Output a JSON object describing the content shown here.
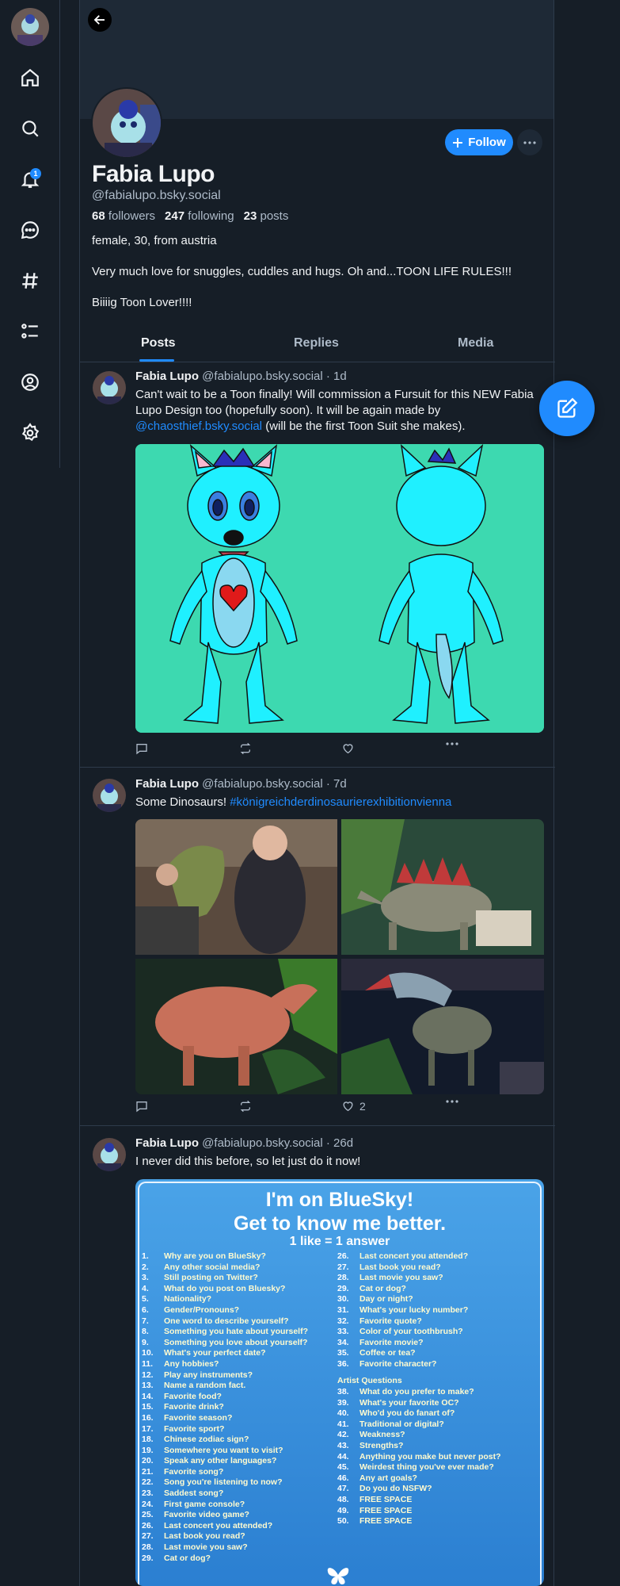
{
  "nav": {
    "items": [
      {
        "name": "home",
        "icon": "home-icon"
      },
      {
        "name": "search",
        "icon": "search-icon"
      },
      {
        "name": "notifications",
        "icon": "bell-icon",
        "badge": "1"
      },
      {
        "name": "chat",
        "icon": "chat-icon"
      },
      {
        "name": "feeds",
        "icon": "hashtag-icon"
      },
      {
        "name": "lists",
        "icon": "list-icon"
      },
      {
        "name": "profile",
        "icon": "profile-icon"
      },
      {
        "name": "settings",
        "icon": "gear-icon"
      }
    ]
  },
  "profile": {
    "name": "Fabia Lupo",
    "handle": "@fabialupo.bsky.social",
    "followers_count": "68",
    "followers_label": "followers",
    "following_count": "247",
    "following_label": "following",
    "posts_count": "23",
    "posts_label": "posts",
    "bio_line1": "female, 30, from austria",
    "bio_line2": "Very much love for snuggles, cuddles and hugs. Oh and...TOON LIFE RULES!!!",
    "bio_line3": "Biiiig Toon Lover!!!!",
    "follow_label": "Follow"
  },
  "tabs": [
    "Posts",
    "Replies",
    "Media"
  ],
  "posts": [
    {
      "author": "Fabia Lupo",
      "handle": "@fabialupo.bsky.social",
      "time": "· 1d",
      "text_before": "Can't wait to be a Toon finally! Will commission a Fursuit for this NEW Fabia Lupo Design too (hopefully soon). It will be again made by ",
      "mention": "@chaosthief.bsky.social",
      "text_after": " (will be the first Toon Suit she makes).",
      "likes": ""
    },
    {
      "author": "Fabia Lupo",
      "handle": "@fabialupo.bsky.social",
      "time": "· 7d",
      "text": "Some Dinosaurs! ",
      "hashtag": "#königreichderdinosaurierexhibitionvienna",
      "likes": "2"
    },
    {
      "author": "Fabia Lupo",
      "handle": "@fabialupo.bsky.social",
      "time": "· 26d",
      "text": "I never did this before, so let just do it now!",
      "likes": ""
    }
  ],
  "quiz": {
    "title1": "I'm on BlueSky!",
    "title2": "Get to know me better.",
    "subtitle": "1 like = 1 answer",
    "left": [
      [
        "1.",
        "Why are you on BlueSky?"
      ],
      [
        "2.",
        "Any other social media?"
      ],
      [
        "3.",
        "Still posting on Twitter?"
      ],
      [
        "4.",
        "What do you post on Bluesky?"
      ],
      [
        "5.",
        "Nationality?"
      ],
      [
        "6.",
        "Gender/Pronouns?"
      ],
      [
        "7.",
        "One word to describe yourself?"
      ],
      [
        "8.",
        "Something you hate about yourself?"
      ],
      [
        "9.",
        "Something you love about yourself?"
      ],
      [
        "10.",
        "What's your perfect date?"
      ],
      [
        "11.",
        "Any hobbies?"
      ],
      [
        "12.",
        "Play any instruments?"
      ],
      [
        "13.",
        "Name a random fact."
      ],
      [
        "14.",
        "Favorite food?"
      ],
      [
        "15.",
        "Favorite drink?"
      ],
      [
        "16.",
        "Favorite season?"
      ],
      [
        "17.",
        "Favorite sport?"
      ],
      [
        "18.",
        "Chinese zodiac sign?"
      ],
      [
        "19.",
        "Somewhere you want to visit?"
      ],
      [
        "20.",
        "Speak any other languages?"
      ],
      [
        "21.",
        "Favorite song?"
      ],
      [
        "22.",
        "Song you're listening to now?"
      ],
      [
        "23.",
        "Saddest song?"
      ],
      [
        "24.",
        "First game console?"
      ],
      [
        "25.",
        "Favorite video game?"
      ],
      [
        "26.",
        "Last concert you attended?"
      ],
      [
        "27.",
        "Last book you read?"
      ],
      [
        "28.",
        "Last movie you saw?"
      ],
      [
        "29.",
        "Cat or dog?"
      ]
    ],
    "right": [
      [
        "26.",
        "Last concert you attended?"
      ],
      [
        "27.",
        "Last book you read?"
      ],
      [
        "28.",
        "Last movie you saw?"
      ],
      [
        "29.",
        "Cat or dog?"
      ],
      [
        "30.",
        "Day or night?"
      ],
      [
        "31.",
        "What's your lucky number?"
      ],
      [
        "32.",
        "Favorite quote?"
      ],
      [
        "33.",
        "Color of your toothbrush?"
      ],
      [
        "34.",
        "Favorite movie?"
      ],
      [
        "35.",
        "Coffee or tea?"
      ],
      [
        "36.",
        "Favorite character?"
      ]
    ],
    "artist_heading": "Artist Questions",
    "artist": [
      [
        "38.",
        "What do you prefer to make?"
      ],
      [
        "39.",
        "What's your favorite OC?"
      ],
      [
        "40.",
        "Who'd you do fanart of?"
      ],
      [
        "41.",
        "Traditional or digital?"
      ],
      [
        "42.",
        "Weakness?"
      ],
      [
        "43.",
        "Strengths?"
      ],
      [
        "44.",
        "Anything you make but never post?"
      ],
      [
        "45.",
        "Weirdest thing you've ever made?"
      ],
      [
        "46.",
        "Any art goals?"
      ],
      [
        "47.",
        "Do you do NSFW?"
      ],
      [
        "48.",
        "FREE SPACE"
      ],
      [
        "49.",
        "FREE SPACE"
      ],
      [
        "50.",
        "FREE SPACE"
      ]
    ]
  },
  "colors": {
    "background": "#161e27",
    "accent": "#208bfe",
    "muted_text": "#aebbc9",
    "border": "#2e3b4b",
    "character_fill": "#1ff0ff",
    "character_bg": "#3dd9b0"
  }
}
